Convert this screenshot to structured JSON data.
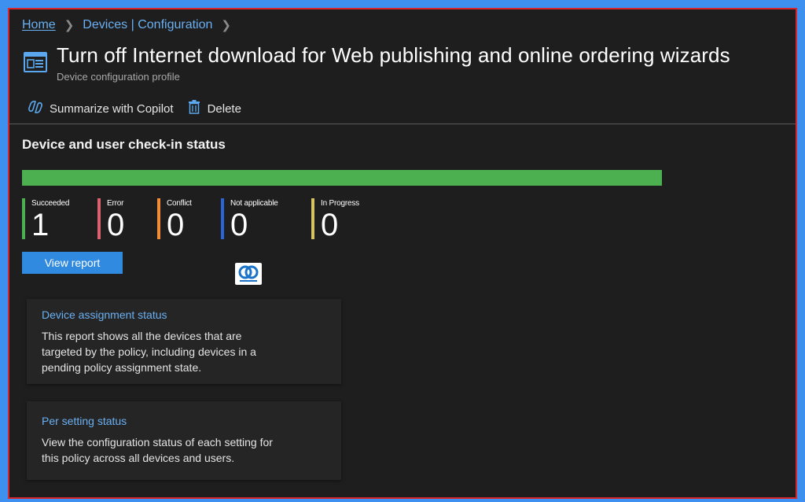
{
  "breadcrumb": {
    "home": "Home",
    "section": "Devices | Configuration"
  },
  "header": {
    "title": "Turn off Internet download for Web publishing and online ordering wizards",
    "subtitle": "Device configuration profile",
    "icon": "device-profile-icon"
  },
  "toolbar": {
    "copilot_label": "Summarize with Copilot",
    "delete_label": "Delete"
  },
  "checkin": {
    "title": "Device and user check-in status",
    "progress_fraction": 1.0,
    "stats": [
      {
        "label": "Succeeded",
        "value": "1",
        "color": "#4caf50"
      },
      {
        "label": "Error",
        "value": "0",
        "color": "#d9626e"
      },
      {
        "label": "Conflict",
        "value": "0",
        "color": "#f28c38"
      },
      {
        "label": "Not applicable",
        "value": "0",
        "color": "#2b63d9"
      },
      {
        "label": "In Progress",
        "value": "0",
        "color": "#d9c261"
      }
    ],
    "view_report_label": "View report"
  },
  "cards": [
    {
      "title": "Device assignment status",
      "description": "This report shows all the devices that are targeted by the policy, including devices in a pending policy assignment state."
    },
    {
      "title": "Per setting status",
      "description": "View the configuration status of each setting for this policy across all devices and users."
    }
  ],
  "colors": {
    "accent": "#6ab0f3",
    "button": "#2f8ae0",
    "background": "#1e1e1e",
    "frame_border": "#d9262d"
  }
}
